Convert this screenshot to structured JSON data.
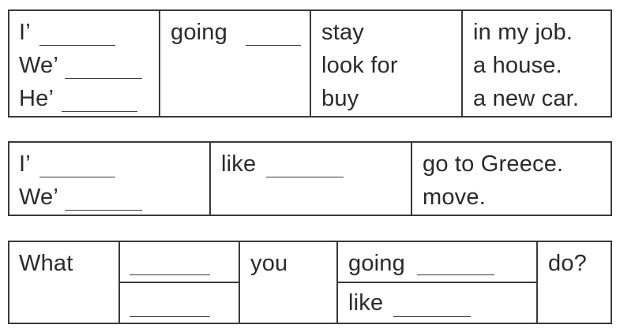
{
  "table1": {
    "col1": [
      "I’",
      "We’",
      "He’"
    ],
    "col2": "going",
    "col3": [
      "stay",
      "look for",
      "buy"
    ],
    "col4": [
      "in my job.",
      "a house.",
      "a new car."
    ]
  },
  "table2": {
    "col1": [
      "I’",
      "We’"
    ],
    "col2": "like",
    "col3": [
      "go to Greece.",
      "move."
    ]
  },
  "table3": {
    "col1": "What",
    "col3": "you",
    "col4_top": "going",
    "col4_bottom": "like",
    "col5": "do?"
  }
}
